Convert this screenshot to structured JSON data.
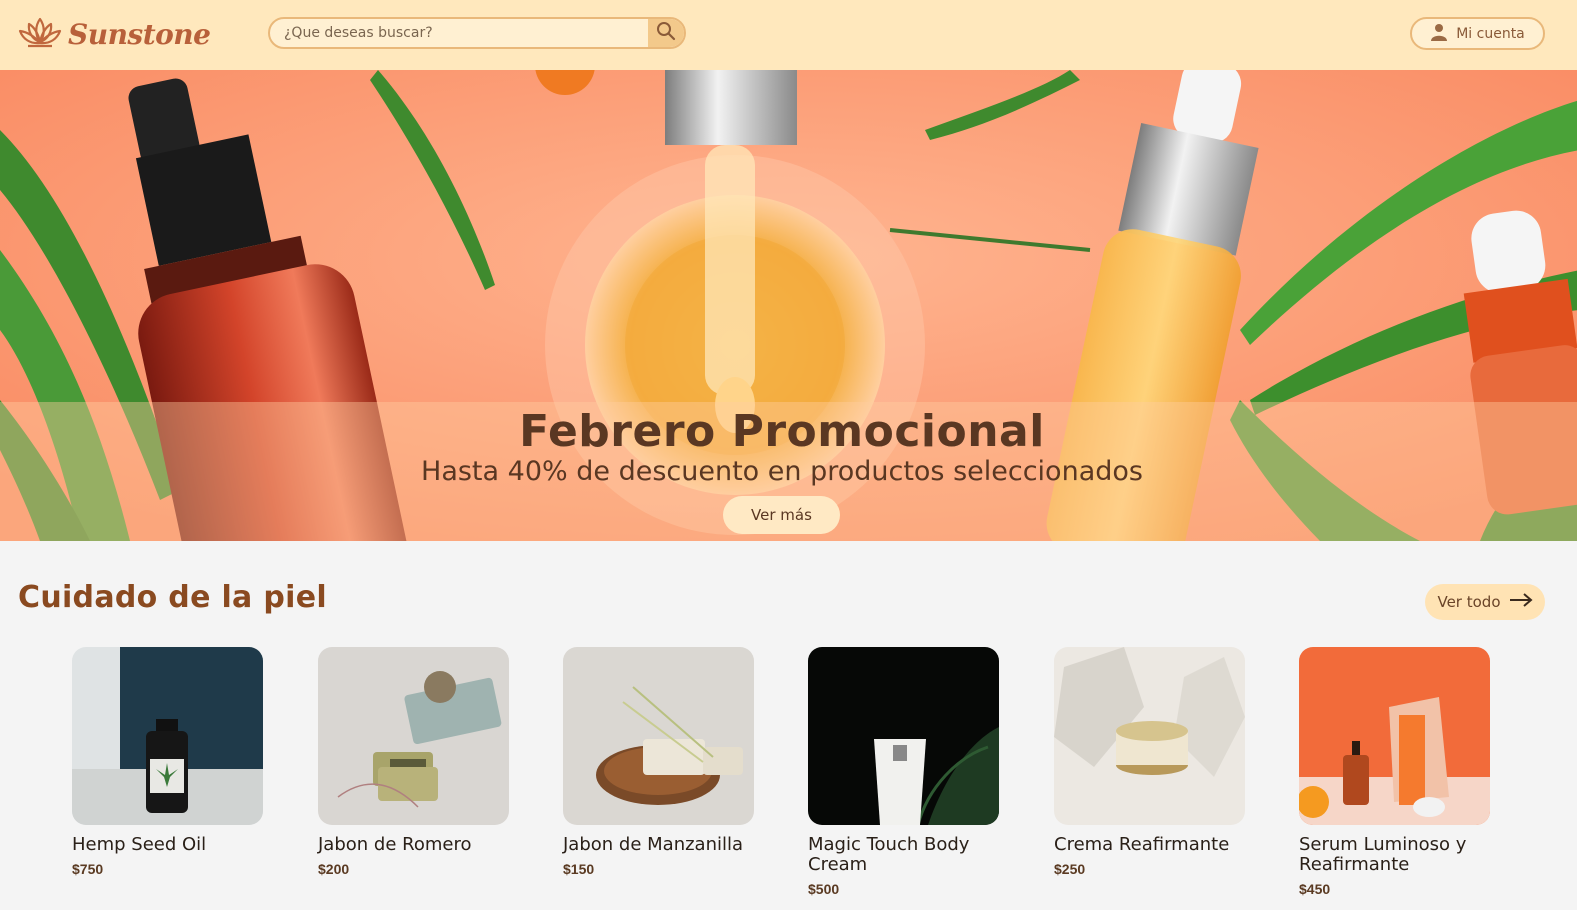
{
  "header": {
    "brand": "Sunstone",
    "search_placeholder": "¿Que deseas buscar?",
    "account_label": "Mi cuenta"
  },
  "hero": {
    "title": "Febrero Promocional",
    "subtitle": "Hasta 40% de descuento en productos seleccionados",
    "cta_label": "Ver más"
  },
  "section": {
    "title": "Cuidado de la piel",
    "see_all_label": "Ver todo"
  },
  "products": [
    {
      "name": "Hemp Seed Oil",
      "price": "$750"
    },
    {
      "name": "Jabon de Romero",
      "price": "$200"
    },
    {
      "name": "Jabon de Manzanilla",
      "price": "$150"
    },
    {
      "name": "Magic Touch Body Cream",
      "price": "$500"
    },
    {
      "name": "Crema Reafirmante",
      "price": "$250"
    },
    {
      "name": "Serum Luminoso y Reafirmante",
      "price": "$450"
    }
  ],
  "colors": {
    "header_bg": "#ffe8bd",
    "accent": "#b8603a",
    "hero_bg": "#fba27e",
    "page_bg": "#f4f4f4"
  },
  "icons": {
    "logo": "lotus-icon",
    "search": "search-icon",
    "account": "user-icon",
    "see_all": "arrow-right-icon"
  }
}
